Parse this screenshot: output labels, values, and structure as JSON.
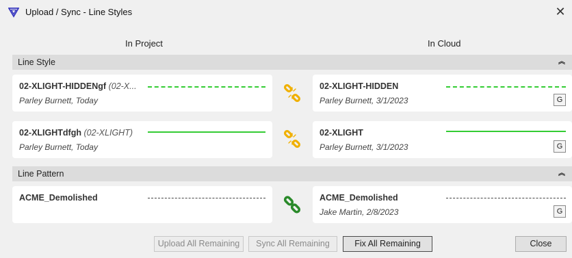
{
  "window": {
    "title": "Upload / Sync - Line Styles",
    "close_glyph": "✕"
  },
  "columns": {
    "left": "In Project",
    "right": "In Cloud"
  },
  "sections": [
    {
      "label": "Line Style",
      "rows": [
        {
          "project": {
            "name": "02-XLIGHT-HIDDENgf",
            "alias": "(02-X...",
            "meta": "Parley Burnett, Today",
            "line": "dashed-green"
          },
          "status_icon": "broken-link-icon",
          "cloud": {
            "name": "02-XLIGHT-HIDDEN",
            "meta": "Parley Burnett, 3/1/2023",
            "line": "dashed-green",
            "button": "G"
          }
        },
        {
          "project": {
            "name": "02-XLIGHTdfgh",
            "alias": "(02-XLIGHT)",
            "meta": "Parley Burnett, Today",
            "line": "solid-green"
          },
          "status_icon": "broken-link-icon",
          "cloud": {
            "name": "02-XLIGHT",
            "meta": "Parley Burnett, 3/1/2023",
            "line": "solid-green",
            "button": "G"
          }
        }
      ]
    },
    {
      "label": "Line Pattern",
      "rows": [
        {
          "project": {
            "name": "ACME_Demolished",
            "alias": "",
            "meta": "",
            "line": "dashed-dark"
          },
          "status_icon": "linked-icon",
          "cloud": {
            "name": "ACME_Demolished",
            "meta": "Jake Martin, 2/8/2023",
            "line": "dashed-dark",
            "button": "G"
          }
        }
      ]
    }
  ],
  "footer": {
    "upload_all": "Upload All Remaining",
    "sync_all": "Sync All Remaining",
    "fix_all": "Fix All Remaining",
    "close": "Close"
  },
  "colors": {
    "broken_link": "#f0b000",
    "linked": "#2a8a2a",
    "line_green": "#33cc33",
    "app_icon": "#3a3ac0"
  }
}
